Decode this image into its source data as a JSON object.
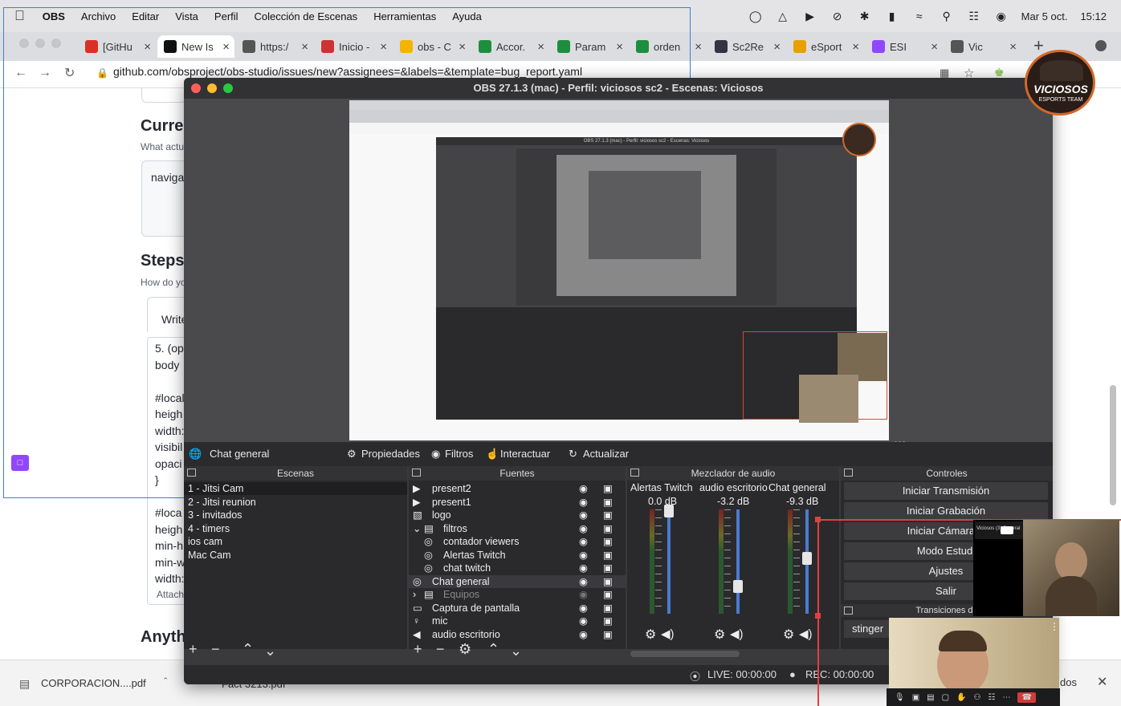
{
  "menubar": {
    "app": "OBS",
    "items": [
      "Archivo",
      "Editar",
      "Vista",
      "Perfil",
      "Colección de Escenas",
      "Herramientas",
      "Ayuda"
    ],
    "date": "Mar 5 oct.",
    "time": "15:12"
  },
  "tabs": [
    {
      "label": "[GitHu",
      "icon": "gmail-icon",
      "color": "#d93025"
    },
    {
      "label": "New Is",
      "icon": "github-icon",
      "color": "#111"
    },
    {
      "label": "https:/",
      "icon": "globe-icon",
      "color": "#555"
    },
    {
      "label": "Inicio -",
      "icon": "heart-icon",
      "color": "#c33"
    },
    {
      "label": "obs - C",
      "icon": "drive-icon",
      "color": "#f4b400"
    },
    {
      "label": "Accor.",
      "icon": "plus-green-icon",
      "color": "#1e8e3e"
    },
    {
      "label": "Param",
      "icon": "plus-green-icon",
      "color": "#1e8e3e"
    },
    {
      "label": "orden",
      "icon": "plus-green-icon",
      "color": "#1e8e3e"
    },
    {
      "label": "Sc2Re",
      "icon": "sc2-icon",
      "color": "#334"
    },
    {
      "label": "eSport",
      "icon": "esport-icon",
      "color": "#e8a000"
    },
    {
      "label": "ESI",
      "icon": "twitch-icon",
      "color": "#9146ff"
    },
    {
      "label": "Vic",
      "icon": "feather-icon",
      "color": "#555"
    }
  ],
  "address": {
    "url": "github.com/obsproject/obs-studio/issues/new?assignees=&labels=&template=bug_report.yaml"
  },
  "github": {
    "current_heading": "Curren",
    "current_sub": "What actu",
    "current_field": "naviga",
    "steps_heading": "Steps",
    "steps_sub": "How do yo",
    "write_tab": "Write",
    "steps_lines": [
      "5. (op",
      "body ",
      "",
      "#local",
      "heigh",
      "width:",
      "visibil",
      "opaci",
      "}",
      "",
      "#loca",
      "heigh",
      "min-h",
      "min-w",
      "width:"
    ],
    "attach": "Attach",
    "anything_heading": "Anyth"
  },
  "downloads": {
    "file1": "CORPORACION....pdf",
    "file2": "Fact 3213.pdf",
    "show_all": "dos"
  },
  "logo": {
    "text": "VICIOSOS",
    "sub": "ESPORTS TEAM"
  },
  "obs": {
    "title": "OBS 27.1.3 (mac) - Perfil: viciosos sc2 - Escenas: Viciosos",
    "toolbar": {
      "source_name": "Chat general",
      "properties": "Propiedades",
      "filters": "Filtros",
      "interact": "Interactuar",
      "refresh": "Actualizar"
    },
    "scenes": {
      "title": "Escenas",
      "items": [
        "1 - Jitsi Cam",
        "2 - Jitsi reunion",
        "3 - invitados",
        "4 - timers",
        "ios cam",
        "Mac Cam"
      ]
    },
    "sources": {
      "title": "Fuentes",
      "items": [
        {
          "label": "present2",
          "icon": "play-icon",
          "indent": 0
        },
        {
          "label": "present1",
          "icon": "play-icon",
          "indent": 0
        },
        {
          "label": "logo",
          "icon": "image-icon",
          "indent": 0
        },
        {
          "label": "filtros",
          "icon": "folder-icon",
          "indent": 0
        },
        {
          "label": "contador viewers",
          "icon": "globe-icon",
          "indent": 1
        },
        {
          "label": "Alertas Twitch",
          "icon": "globe-icon",
          "indent": 1
        },
        {
          "label": "chat twitch",
          "icon": "globe-icon",
          "indent": 1
        },
        {
          "label": "Chat general",
          "icon": "globe-icon",
          "indent": 0
        },
        {
          "label": "Equipos",
          "icon": "folder-icon",
          "indent": 0
        },
        {
          "label": "Captura de pantalla",
          "icon": "monitor-icon",
          "indent": 0
        },
        {
          "label": "mic",
          "icon": "mic-icon",
          "indent": 0
        },
        {
          "label": "audio escritorio",
          "icon": "speaker-icon",
          "indent": 0
        }
      ]
    },
    "mixer": {
      "title": "Mezclador de audio",
      "channels": [
        {
          "name": "Alertas Twitch",
          "db": "0.0 dB",
          "level": 0.0
        },
        {
          "name": "audio escritorio",
          "db": "-3.2 dB",
          "level": 0.72
        },
        {
          "name": "Chat general",
          "db": "-9.3 dB",
          "level": 0.45
        }
      ]
    },
    "controls": {
      "title": "Controles",
      "start_stream": "Iniciar Transmisión",
      "start_record": "Iniciar Grabación",
      "virtual_cam": "Iniciar Cámara V",
      "studio_mode": "Modo Estudi",
      "settings": "Ajustes",
      "exit": "Salir",
      "transitions_title": "Transiciones de",
      "transition": "stinger"
    },
    "status": {
      "live": "LIVE: 00:00:00",
      "rec": "REC: 00:00:00"
    },
    "preview_size": [
      "698",
      "440"
    ]
  },
  "inner_obs_title": "OBS 27.1.3 (mac) - Perfil: viciosos sc2 - Escenas: Viciosos",
  "camera_label": "Viciosos (3) General"
}
